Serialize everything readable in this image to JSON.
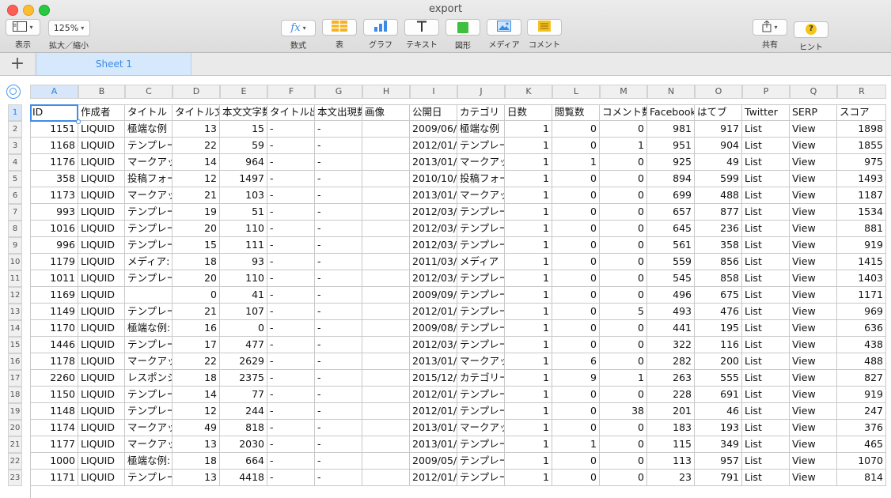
{
  "window": {
    "title": "export"
  },
  "toolbar": {
    "view_label": "表示",
    "zoom_value": "125%",
    "zoom_label": "拡大／縮小",
    "formula_label": "数式",
    "table_label": "表",
    "chart_label": "グラフ",
    "text_label": "テキスト",
    "shape_label": "図形",
    "media_label": "メディア",
    "comment_label": "コメント",
    "share_label": "共有",
    "hint_label": "ヒント"
  },
  "sheets": [
    {
      "label": "Sheet 1",
      "active": true
    }
  ],
  "columns": [
    "A",
    "B",
    "C",
    "D",
    "E",
    "F",
    "G",
    "H",
    "I",
    "J",
    "K",
    "L",
    "M",
    "N",
    "O",
    "P",
    "Q",
    "R"
  ],
  "column_align": [
    "num",
    "text",
    "text",
    "num",
    "num",
    "text",
    "text",
    "text",
    "text",
    "text",
    "num",
    "num",
    "num",
    "num",
    "num",
    "text",
    "text",
    "num"
  ],
  "header_row": [
    "ID",
    "作成者",
    "タイトル",
    "タイトル文",
    "本文文字数",
    "タイトル出",
    "本文出現数",
    "画像",
    "公開日",
    "カテゴリ",
    "日数",
    "閲覧数",
    "コメント数",
    "Facebook",
    "はてブ",
    "Twitter",
    "SERP",
    "スコア"
  ],
  "rows": [
    [
      "1151",
      "LIQUID",
      "極端な例",
      "13",
      "15",
      "-",
      "-",
      "",
      "2009/06/",
      "極端な例",
      "1",
      "0",
      "0",
      "981",
      "917",
      "List",
      "View",
      "1898"
    ],
    [
      "1168",
      "LIQUID",
      "テンプレー",
      "22",
      "59",
      "-",
      "-",
      "",
      "2012/01/",
      "テンプレー",
      "1",
      "0",
      "1",
      "951",
      "904",
      "List",
      "View",
      "1855"
    ],
    [
      "1176",
      "LIQUID",
      "マークアッ",
      "14",
      "964",
      "-",
      "-",
      "",
      "2013/01/",
      "マークアッ",
      "1",
      "1",
      "0",
      "925",
      "49",
      "List",
      "View",
      "975"
    ],
    [
      "358",
      "LIQUID",
      "投稿フォー",
      "12",
      "1497",
      "-",
      "-",
      "",
      "2010/10/",
      "投稿フォー",
      "1",
      "0",
      "0",
      "894",
      "599",
      "List",
      "View",
      "1493"
    ],
    [
      "1173",
      "LIQUID",
      "マークアッ",
      "21",
      "103",
      "-",
      "-",
      "",
      "2013/01/",
      "マークアッ",
      "1",
      "0",
      "0",
      "699",
      "488",
      "List",
      "View",
      "1187"
    ],
    [
      "993",
      "LIQUID",
      "テンプレー",
      "19",
      "51",
      "-",
      "-",
      "",
      "2012/03/",
      "テンプレー",
      "1",
      "0",
      "0",
      "657",
      "877",
      "List",
      "View",
      "1534"
    ],
    [
      "1016",
      "LIQUID",
      "テンプレー",
      "20",
      "110",
      "-",
      "-",
      "",
      "2012/03/",
      "テンプレー",
      "1",
      "0",
      "0",
      "645",
      "236",
      "List",
      "View",
      "881"
    ],
    [
      "996",
      "LIQUID",
      "テンプレー",
      "15",
      "111",
      "-",
      "-",
      "",
      "2012/03/",
      "テンプレー",
      "1",
      "0",
      "0",
      "561",
      "358",
      "List",
      "View",
      "919"
    ],
    [
      "1179",
      "LIQUID",
      "メディア:",
      "18",
      "93",
      "-",
      "-",
      "",
      "2011/03/",
      "メディア",
      "1",
      "0",
      "0",
      "559",
      "856",
      "List",
      "View",
      "1415"
    ],
    [
      "1011",
      "LIQUID",
      "テンプレー",
      "20",
      "110",
      "-",
      "-",
      "",
      "2012/03/",
      "テンプレー",
      "1",
      "0",
      "0",
      "545",
      "858",
      "List",
      "View",
      "1403"
    ],
    [
      "1169",
      "LIQUID",
      "",
      "0",
      "41",
      "-",
      "-",
      "",
      "2009/09/",
      "テンプレー",
      "1",
      "0",
      "0",
      "496",
      "675",
      "List",
      "View",
      "1171"
    ],
    [
      "1149",
      "LIQUID",
      "テンプレー",
      "21",
      "107",
      "-",
      "-",
      "",
      "2012/01/",
      "テンプレー",
      "1",
      "0",
      "5",
      "493",
      "476",
      "List",
      "View",
      "969"
    ],
    [
      "1170",
      "LIQUID",
      "極端な例:",
      "16",
      "0",
      "-",
      "-",
      "",
      "2009/08/",
      "テンプレー",
      "1",
      "0",
      "0",
      "441",
      "195",
      "List",
      "View",
      "636"
    ],
    [
      "1446",
      "LIQUID",
      "テンプレー",
      "17",
      "477",
      "-",
      "-",
      "",
      "2012/03/",
      "テンプレー",
      "1",
      "0",
      "0",
      "322",
      "116",
      "List",
      "View",
      "438"
    ],
    [
      "1178",
      "LIQUID",
      "マークアッ",
      "22",
      "2629",
      "-",
      "-",
      "",
      "2013/01/",
      "マークアッ",
      "1",
      "6",
      "0",
      "282",
      "200",
      "List",
      "View",
      "488"
    ],
    [
      "2260",
      "LIQUID",
      "レスポンシ",
      "18",
      "2375",
      "-",
      "-",
      "",
      "2015/12/",
      "カテゴリー",
      "1",
      "9",
      "1",
      "263",
      "555",
      "List",
      "View",
      "827"
    ],
    [
      "1150",
      "LIQUID",
      "テンプレー",
      "14",
      "77",
      "-",
      "-",
      "",
      "2012/01/",
      "テンプレー",
      "1",
      "0",
      "0",
      "228",
      "691",
      "List",
      "View",
      "919"
    ],
    [
      "1148",
      "LIQUID",
      "テンプレー",
      "12",
      "244",
      "-",
      "-",
      "",
      "2012/01/",
      "テンプレー",
      "1",
      "0",
      "38",
      "201",
      "46",
      "List",
      "View",
      "247"
    ],
    [
      "1174",
      "LIQUID",
      "マークアッ",
      "49",
      "818",
      "-",
      "-",
      "",
      "2013/01/",
      "マークアッ",
      "1",
      "0",
      "0",
      "183",
      "193",
      "List",
      "View",
      "376"
    ],
    [
      "1177",
      "LIQUID",
      "マークアッ",
      "13",
      "2030",
      "-",
      "-",
      "",
      "2013/01/",
      "テンプレー",
      "1",
      "1",
      "0",
      "115",
      "349",
      "List",
      "View",
      "465"
    ],
    [
      "1000",
      "LIQUID",
      "極端な例:",
      "18",
      "664",
      "-",
      "-",
      "",
      "2009/05/",
      "テンプレー",
      "1",
      "0",
      "0",
      "113",
      "957",
      "List",
      "View",
      "1070"
    ],
    [
      "1171",
      "LIQUID",
      "テンプレー",
      "13",
      "4418",
      "-",
      "-",
      "",
      "2012/01/",
      "テンプレー",
      "1",
      "0",
      "0",
      "23",
      "791",
      "List",
      "View",
      "814"
    ]
  ],
  "selected_cell": "A1",
  "colors": {
    "accent": "#3d8de8",
    "selection_header": "#d7e7f9"
  },
  "icons": [
    "view-sidebar-icon",
    "formula-fx-icon",
    "table-icon",
    "chart-bar-icon",
    "text-icon",
    "shape-icon",
    "media-icon",
    "comment-icon",
    "share-icon",
    "hint-icon",
    "add-sheet-icon",
    "select-all-icon"
  ]
}
